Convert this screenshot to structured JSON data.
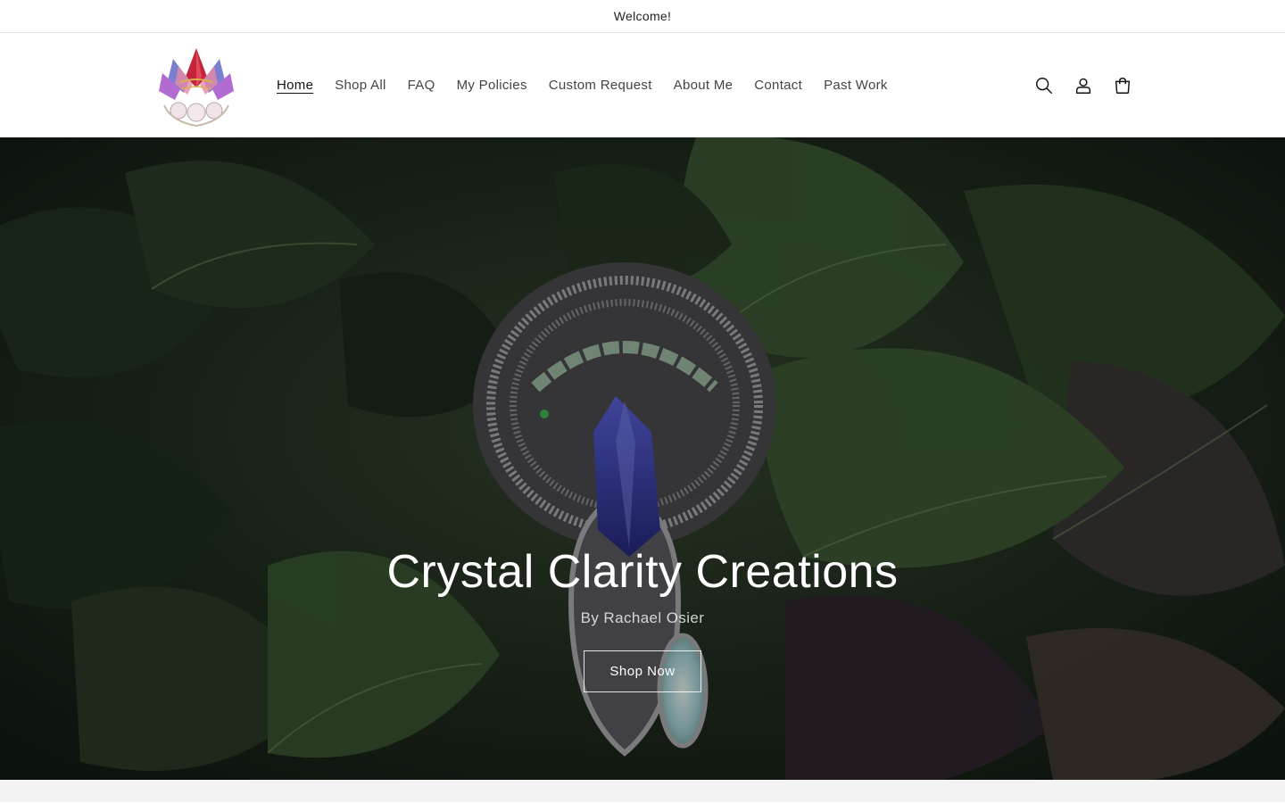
{
  "announcement": {
    "text": "Welcome!"
  },
  "header": {
    "logo_alt": "Crystal Clarity Creations logo",
    "nav": [
      {
        "label": "Home",
        "active": true
      },
      {
        "label": "Shop All"
      },
      {
        "label": "FAQ"
      },
      {
        "label": "My Policies"
      },
      {
        "label": "Custom Request"
      },
      {
        "label": "About Me"
      },
      {
        "label": "Contact"
      },
      {
        "label": "Past Work"
      }
    ],
    "icons": [
      "search-icon",
      "account-icon",
      "cart-icon"
    ]
  },
  "hero": {
    "title": "Crystal Clarity Creations",
    "subtitle": "By Rachael Osier",
    "button_label": "Shop Now"
  },
  "colors": {
    "text": "#121212",
    "nav_text": "#444444",
    "leaf_dark": "#1f2d1f",
    "leaf_green": "#4e6b3c",
    "gem_blue": "#3b3f9e",
    "wire_silver": "#a9a9ad"
  }
}
